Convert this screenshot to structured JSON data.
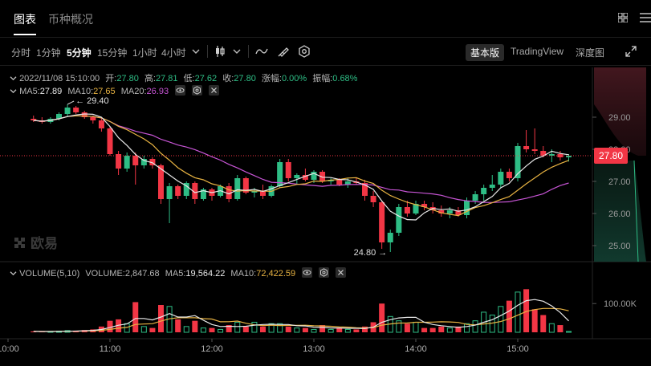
{
  "tabs": {
    "chart": "图表",
    "overview": "币种概况"
  },
  "toolbar": {
    "timeframes": [
      "分时",
      "1分钟",
      "5分钟",
      "15分钟",
      "1小时",
      "4小时"
    ],
    "active_timeframe": "5分钟",
    "views": {
      "basic": "基本版",
      "tradingview": "TradingView",
      "depth": "深度图"
    }
  },
  "ohlc_info": {
    "datetime": "2022/11/08 15:10:00",
    "open_label": "开:",
    "open": "27.80",
    "high_label": "高:",
    "high": "27.81",
    "low_label": "低:",
    "low": "27.62",
    "close_label": "收:",
    "close": "27.80",
    "change_label": "涨幅:",
    "change": "0.00%",
    "amplitude_label": "振幅:",
    "amplitude": "0.68%"
  },
  "ma_info": {
    "ma5_label": "MA5:",
    "ma5": "27.89",
    "ma10_label": "MA10:",
    "ma10": "27.65",
    "ma20_label": "MA20:",
    "ma20": "26.93"
  },
  "volume_info": {
    "label": "VOLUME(5,10)",
    "volume_label": "VOLUME:",
    "volume": "2,847.68",
    "ma5_label": "MA5:",
    "ma5": "19,564.22",
    "ma10_label": "MA10:",
    "ma10": "72,422.59"
  },
  "watermark": "欧易",
  "colors": {
    "up": "#2ebd85",
    "down": "#f23645",
    "ma5": "#e8e8e8",
    "ma10": "#e8b342",
    "ma20": "#c855d6",
    "background": "#000000"
  },
  "chart_data": {
    "type": "candlestick",
    "price_axis": {
      "ticks": [
        "29.00",
        "28.00",
        "27.00",
        "26.00",
        "25.00"
      ],
      "range": [
        24.4,
        30.4
      ]
    },
    "time_axis": {
      "ticks": [
        "10:00",
        "11:00",
        "12:00",
        "13:00",
        "14:00",
        "15:00"
      ]
    },
    "current_price": "27.80",
    "annotations": {
      "high": "29.40",
      "low": "24.80"
    },
    "volume_axis": {
      "ticks": [
        "100.00K"
      ],
      "range": [
        0,
        190000
      ]
    },
    "candles": [
      {
        "t": "10:15",
        "o": 28.95,
        "h": 29.05,
        "l": 28.85,
        "c": 28.9,
        "v": 3000
      },
      {
        "t": "10:20",
        "o": 28.9,
        "h": 29.0,
        "l": 28.8,
        "c": 28.85,
        "v": 2500
      },
      {
        "t": "10:25",
        "o": 28.85,
        "h": 29.0,
        "l": 28.8,
        "c": 28.95,
        "v": 3000
      },
      {
        "t": "10:30",
        "o": 28.95,
        "h": 29.15,
        "l": 28.9,
        "c": 29.1,
        "v": 4000
      },
      {
        "t": "10:35",
        "o": 29.1,
        "h": 29.4,
        "l": 29.0,
        "c": 29.3,
        "v": 6000
      },
      {
        "t": "10:40",
        "o": 29.3,
        "h": 29.35,
        "l": 29.1,
        "c": 29.15,
        "v": 5000
      },
      {
        "t": "10:45",
        "o": 29.15,
        "h": 29.2,
        "l": 28.95,
        "c": 29.0,
        "v": 8000
      },
      {
        "t": "10:50",
        "o": 29.0,
        "h": 29.05,
        "l": 28.8,
        "c": 28.9,
        "v": 10000
      },
      {
        "t": "10:55",
        "o": 28.9,
        "h": 29.0,
        "l": 28.55,
        "c": 28.65,
        "v": 20000
      },
      {
        "t": "11:00",
        "o": 28.65,
        "h": 28.7,
        "l": 27.8,
        "c": 27.85,
        "v": 40000
      },
      {
        "t": "11:05",
        "o": 27.85,
        "h": 27.95,
        "l": 27.2,
        "c": 27.4,
        "v": 45000
      },
      {
        "t": "11:10",
        "o": 27.4,
        "h": 27.9,
        "l": 27.3,
        "c": 27.8,
        "v": 30000
      },
      {
        "t": "11:15",
        "o": 27.8,
        "h": 27.9,
        "l": 26.9,
        "c": 27.5,
        "v": 105000
      },
      {
        "t": "11:20",
        "o": 27.5,
        "h": 27.8,
        "l": 27.4,
        "c": 27.7,
        "v": 20000
      },
      {
        "t": "11:25",
        "o": 27.7,
        "h": 27.75,
        "l": 27.4,
        "c": 27.5,
        "v": 15000
      },
      {
        "t": "11:30",
        "o": 27.5,
        "h": 27.55,
        "l": 26.3,
        "c": 26.45,
        "v": 95000
      },
      {
        "t": "11:35",
        "o": 26.45,
        "h": 26.95,
        "l": 25.7,
        "c": 26.85,
        "v": 90000
      },
      {
        "t": "11:40",
        "o": 26.85,
        "h": 26.9,
        "l": 26.45,
        "c": 26.55,
        "v": 45000
      },
      {
        "t": "11:45",
        "o": 26.55,
        "h": 27.0,
        "l": 26.45,
        "c": 26.95,
        "v": 20000
      },
      {
        "t": "11:50",
        "o": 26.95,
        "h": 27.0,
        "l": 26.3,
        "c": 26.45,
        "v": 40000
      },
      {
        "t": "11:55",
        "o": 26.45,
        "h": 26.8,
        "l": 26.4,
        "c": 26.75,
        "v": 15000
      },
      {
        "t": "12:00",
        "o": 26.75,
        "h": 26.8,
        "l": 26.4,
        "c": 26.55,
        "v": 15000
      },
      {
        "t": "12:05",
        "o": 26.55,
        "h": 26.9,
        "l": 26.5,
        "c": 26.85,
        "v": 10000
      },
      {
        "t": "12:10",
        "o": 26.85,
        "h": 26.95,
        "l": 26.35,
        "c": 26.45,
        "v": 25000
      },
      {
        "t": "12:15",
        "o": 26.45,
        "h": 27.2,
        "l": 26.4,
        "c": 27.1,
        "v": 35000
      },
      {
        "t": "12:20",
        "o": 27.1,
        "h": 27.15,
        "l": 26.6,
        "c": 26.65,
        "v": 20000
      },
      {
        "t": "12:25",
        "o": 26.65,
        "h": 26.8,
        "l": 26.5,
        "c": 26.7,
        "v": 35000
      },
      {
        "t": "12:30",
        "o": 26.7,
        "h": 26.9,
        "l": 26.45,
        "c": 26.55,
        "v": 20000
      },
      {
        "t": "12:35",
        "o": 26.55,
        "h": 26.9,
        "l": 26.5,
        "c": 26.85,
        "v": 30000
      },
      {
        "t": "12:40",
        "o": 26.85,
        "h": 27.7,
        "l": 26.8,
        "c": 27.6,
        "v": 30000
      },
      {
        "t": "12:45",
        "o": 27.6,
        "h": 27.7,
        "l": 27.0,
        "c": 27.1,
        "v": 20000
      },
      {
        "t": "12:50",
        "o": 27.1,
        "h": 27.25,
        "l": 26.9,
        "c": 27.2,
        "v": 15000
      },
      {
        "t": "12:55",
        "o": 27.2,
        "h": 27.4,
        "l": 27.0,
        "c": 27.05,
        "v": 15000
      },
      {
        "t": "13:00",
        "o": 27.05,
        "h": 27.35,
        "l": 26.95,
        "c": 27.3,
        "v": 10000
      },
      {
        "t": "13:05",
        "o": 27.3,
        "h": 27.35,
        "l": 26.95,
        "c": 27.0,
        "v": 25000
      },
      {
        "t": "13:10",
        "o": 27.0,
        "h": 27.1,
        "l": 26.9,
        "c": 27.05,
        "v": 10000
      },
      {
        "t": "13:15",
        "o": 27.05,
        "h": 27.1,
        "l": 26.85,
        "c": 26.9,
        "v": 15000
      },
      {
        "t": "13:20",
        "o": 26.9,
        "h": 27.1,
        "l": 26.8,
        "c": 27.0,
        "v": 10000
      },
      {
        "t": "13:25",
        "o": 27.0,
        "h": 27.1,
        "l": 26.9,
        "c": 26.95,
        "v": 10000
      },
      {
        "t": "13:30",
        "o": 26.95,
        "h": 27.05,
        "l": 26.4,
        "c": 26.55,
        "v": 20000
      },
      {
        "t": "13:35",
        "o": 26.55,
        "h": 26.7,
        "l": 26.2,
        "c": 26.35,
        "v": 35000
      },
      {
        "t": "13:40",
        "o": 26.35,
        "h": 26.4,
        "l": 24.9,
        "c": 25.1,
        "v": 100000
      },
      {
        "t": "13:45",
        "o": 25.1,
        "h": 25.5,
        "l": 24.8,
        "c": 25.4,
        "v": 55000
      },
      {
        "t": "13:50",
        "o": 25.4,
        "h": 26.3,
        "l": 25.3,
        "c": 26.2,
        "v": 40000
      },
      {
        "t": "13:55",
        "o": 26.2,
        "h": 26.4,
        "l": 25.9,
        "c": 26.0,
        "v": 30000
      },
      {
        "t": "14:00",
        "o": 26.0,
        "h": 26.4,
        "l": 25.95,
        "c": 26.3,
        "v": 35000
      },
      {
        "t": "14:05",
        "o": 26.3,
        "h": 26.4,
        "l": 26.1,
        "c": 26.2,
        "v": 15000
      },
      {
        "t": "14:10",
        "o": 26.2,
        "h": 26.35,
        "l": 26.0,
        "c": 26.1,
        "v": 15000
      },
      {
        "t": "14:15",
        "o": 26.1,
        "h": 26.25,
        "l": 25.9,
        "c": 26.0,
        "v": 20000
      },
      {
        "t": "14:20",
        "o": 26.0,
        "h": 26.2,
        "l": 25.85,
        "c": 26.1,
        "v": 15000
      },
      {
        "t": "14:25",
        "o": 26.1,
        "h": 26.2,
        "l": 25.9,
        "c": 25.95,
        "v": 20000
      },
      {
        "t": "14:30",
        "o": 25.95,
        "h": 26.5,
        "l": 25.85,
        "c": 26.4,
        "v": 30000
      },
      {
        "t": "14:35",
        "o": 26.4,
        "h": 26.7,
        "l": 26.3,
        "c": 26.6,
        "v": 40000
      },
      {
        "t": "14:40",
        "o": 26.6,
        "h": 26.9,
        "l": 26.4,
        "c": 26.8,
        "v": 70000
      },
      {
        "t": "14:45",
        "o": 26.8,
        "h": 27.2,
        "l": 26.7,
        "c": 26.9,
        "v": 60000
      },
      {
        "t": "14:50",
        "o": 26.9,
        "h": 27.4,
        "l": 26.8,
        "c": 27.3,
        "v": 90000
      },
      {
        "t": "14:55",
        "o": 27.3,
        "h": 27.4,
        "l": 27.0,
        "c": 27.1,
        "v": 110000
      },
      {
        "t": "15:00",
        "o": 27.1,
        "h": 28.2,
        "l": 27.0,
        "c": 28.1,
        "v": 140000
      },
      {
        "t": "15:05",
        "o": 28.1,
        "h": 28.6,
        "l": 27.9,
        "c": 28.0,
        "v": 150000
      },
      {
        "t": "15:10",
        "o": 28.0,
        "h": 28.65,
        "l": 27.85,
        "c": 27.95,
        "v": 80000
      },
      {
        "t": "15:15",
        "o": 27.95,
        "h": 28.1,
        "l": 27.75,
        "c": 27.8,
        "v": 60000
      },
      {
        "t": "15:20",
        "o": 27.8,
        "h": 28.0,
        "l": 27.6,
        "c": 27.85,
        "v": 30000
      },
      {
        "t": "15:25",
        "o": 27.85,
        "h": 27.95,
        "l": 27.65,
        "c": 27.75,
        "v": 25000
      },
      {
        "t": "15:30",
        "o": 27.75,
        "h": 27.85,
        "l": 27.62,
        "c": 27.8,
        "v": 3000
      }
    ]
  }
}
